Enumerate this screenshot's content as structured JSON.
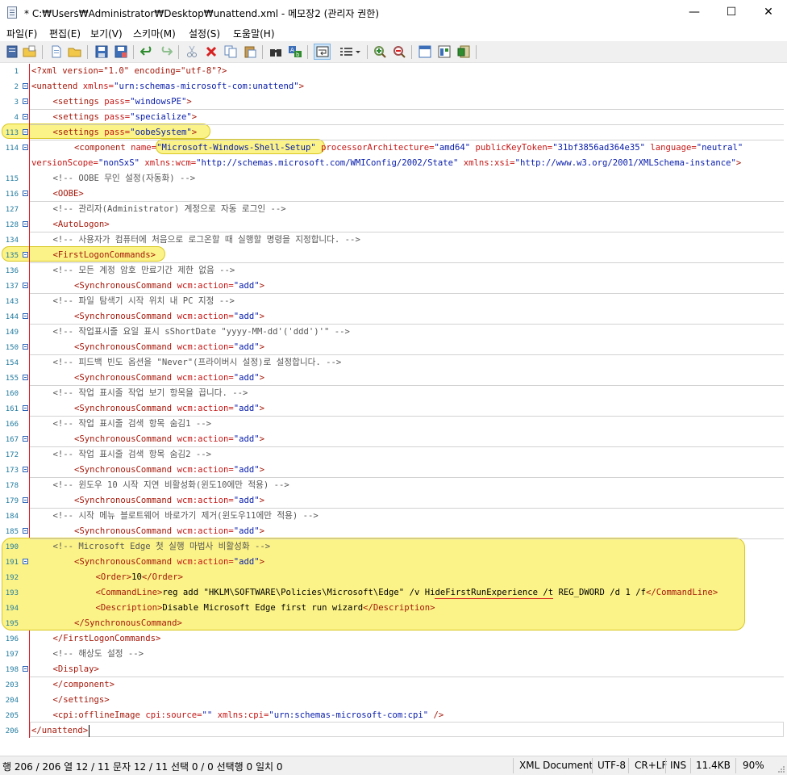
{
  "window": {
    "title": "* C:₩Users₩Administrator₩Desktop₩unattend.xml - 메모장2 (관리자 권한)",
    "minimize": "—",
    "maximize": "☐",
    "close": "✕"
  },
  "menu": [
    "파일(F)",
    "편집(E)",
    "보기(V)",
    "스키마(M)",
    "설정(S)",
    "도움말(H)"
  ],
  "toolbar": {
    "buttons": [
      "new",
      "open",
      "browse",
      "open-file",
      "save",
      "save-as",
      "undo",
      "redo",
      "cut",
      "delete",
      "copy",
      "paste",
      "find",
      "replace",
      "word-wrap",
      "line-numbers",
      "zoom-in",
      "zoom-out",
      "view",
      "settings",
      "export"
    ]
  },
  "lines": [
    {
      "num": "1",
      "fold": false,
      "indent": 0,
      "segs": [
        [
          "pi",
          "<?xml version=\"1.0\" encoding=\"utf-8\"?>"
        ]
      ]
    },
    {
      "num": "2",
      "fold": true,
      "indent": 0,
      "segs": [
        [
          "tag",
          "<unattend "
        ],
        [
          "attr",
          "xmlns="
        ],
        [
          "val",
          "\"urn:schemas-microsoft-com:unattend\""
        ],
        [
          "tag",
          ">"
        ]
      ]
    },
    {
      "num": "3",
      "fold": true,
      "indent": 1,
      "segs": [
        [
          "tag",
          "<settings "
        ],
        [
          "attr",
          "pass="
        ],
        [
          "val",
          "\"windowsPE\""
        ],
        [
          "tag",
          ">"
        ]
      ]
    },
    {
      "num": "4",
      "fold": true,
      "indent": 1,
      "segs": [
        [
          "tag",
          "<settings "
        ],
        [
          "attr",
          "pass="
        ],
        [
          "val",
          "\"specialize\""
        ],
        [
          "tag",
          ">"
        ]
      ]
    },
    {
      "num": "113",
      "fold": true,
      "indent": 1,
      "segs": [
        [
          "tag",
          "<settings "
        ],
        [
          "attr",
          "pass="
        ],
        [
          "val",
          "\"oobeSystem\""
        ],
        [
          "tag",
          ">"
        ]
      ]
    },
    {
      "num": "114",
      "fold": true,
      "indent": 2,
      "segs": [
        [
          "tag",
          "<component "
        ],
        [
          "attr",
          "name="
        ],
        [
          "val",
          "\"Microsoft-Windows-Shell-Setup\""
        ],
        [
          "attr",
          " processorArchitecture="
        ],
        [
          "val",
          "\"amd64\""
        ],
        [
          "attr",
          " publicKeyToken="
        ],
        [
          "val",
          "\"31bf3856ad364e35\""
        ],
        [
          "attr",
          " language="
        ],
        [
          "val",
          "\"neutral\""
        ]
      ]
    },
    {
      "num": "",
      "fold": false,
      "indent": 0,
      "segs": [
        [
          "attr",
          "versionScope="
        ],
        [
          "val",
          "\"nonSxS\""
        ],
        [
          "attr",
          " xmlns:wcm="
        ],
        [
          "val",
          "\"http://schemas.microsoft.com/WMIConfig/2002/State\""
        ],
        [
          "attr",
          " xmlns:xsi="
        ],
        [
          "val",
          "\"http://www.w3.org/2001/XMLSchema-instance\""
        ],
        [
          "tag",
          ">"
        ]
      ]
    },
    {
      "num": "115",
      "fold": false,
      "indent": 1,
      "segs": [
        [
          "cmt",
          "<!-- OOBE 무인 설정(자동화) -->"
        ]
      ]
    },
    {
      "num": "116",
      "fold": true,
      "indent": 1,
      "segs": [
        [
          "tag",
          "<OOBE>"
        ]
      ]
    },
    {
      "num": "127",
      "fold": false,
      "indent": 1,
      "segs": [
        [
          "cmt",
          "<!-- 관리자(Administrator) 계정으로 자동 로그인 -->"
        ]
      ]
    },
    {
      "num": "128",
      "fold": true,
      "indent": 1,
      "segs": [
        [
          "tag",
          "<AutoLogon>"
        ]
      ]
    },
    {
      "num": "134",
      "fold": false,
      "indent": 1,
      "segs": [
        [
          "cmt",
          "<!-- 사용자가 컴퓨터에 처음으로 로그온할 때 실행할 명령을 지정합니다. -->"
        ]
      ]
    },
    {
      "num": "135",
      "fold": true,
      "indent": 1,
      "segs": [
        [
          "tag",
          "<FirstLogonCommands>"
        ]
      ]
    },
    {
      "num": "136",
      "fold": false,
      "indent": 1,
      "segs": [
        [
          "cmt",
          "<!-- 모든 계정 암호 만료기간 제한 없음 -->"
        ]
      ]
    },
    {
      "num": "137",
      "fold": true,
      "indent": 2,
      "segs": [
        [
          "tag",
          "<SynchronousCommand "
        ],
        [
          "attr",
          "wcm:action="
        ],
        [
          "val",
          "\"add\""
        ],
        [
          "tag",
          ">"
        ]
      ]
    },
    {
      "num": "143",
      "fold": false,
      "indent": 1,
      "segs": [
        [
          "cmt",
          "<!-- 파일 탐색기 시작 위치 내 PC 지정 -->"
        ]
      ]
    },
    {
      "num": "144",
      "fold": true,
      "indent": 2,
      "segs": [
        [
          "tag",
          "<SynchronousCommand "
        ],
        [
          "attr",
          "wcm:action="
        ],
        [
          "val",
          "\"add\""
        ],
        [
          "tag",
          ">"
        ]
      ]
    },
    {
      "num": "149",
      "fold": false,
      "indent": 1,
      "segs": [
        [
          "cmt",
          "<!-- 작업표시줄 요일 표시 sShortDate \"yyyy-MM-dd'('ddd')'\" -->"
        ]
      ]
    },
    {
      "num": "150",
      "fold": true,
      "indent": 2,
      "segs": [
        [
          "tag",
          "<SynchronousCommand "
        ],
        [
          "attr",
          "wcm:action="
        ],
        [
          "val",
          "\"add\""
        ],
        [
          "tag",
          ">"
        ]
      ]
    },
    {
      "num": "154",
      "fold": false,
      "indent": 1,
      "segs": [
        [
          "cmt",
          "<!-- 피드백 빈도 옵션을 \"Never\"(프라이버시 설정)로 설정합니다. -->"
        ]
      ]
    },
    {
      "num": "155",
      "fold": true,
      "indent": 2,
      "segs": [
        [
          "tag",
          "<SynchronousCommand "
        ],
        [
          "attr",
          "wcm:action="
        ],
        [
          "val",
          "\"add\""
        ],
        [
          "tag",
          ">"
        ]
      ]
    },
    {
      "num": "160",
      "fold": false,
      "indent": 1,
      "segs": [
        [
          "cmt",
          "<!-- 작업 표시줄 작업 보기 항목을 끕니다. -->"
        ]
      ]
    },
    {
      "num": "161",
      "fold": true,
      "indent": 2,
      "segs": [
        [
          "tag",
          "<SynchronousCommand "
        ],
        [
          "attr",
          "wcm:action="
        ],
        [
          "val",
          "\"add\""
        ],
        [
          "tag",
          ">"
        ]
      ]
    },
    {
      "num": "166",
      "fold": false,
      "indent": 1,
      "segs": [
        [
          "cmt",
          "<!-- 작업 표시줄 검색 항목 숨김1 -->"
        ]
      ]
    },
    {
      "num": "167",
      "fold": true,
      "indent": 2,
      "segs": [
        [
          "tag",
          "<SynchronousCommand "
        ],
        [
          "attr",
          "wcm:action="
        ],
        [
          "val",
          "\"add\""
        ],
        [
          "tag",
          ">"
        ]
      ]
    },
    {
      "num": "172",
      "fold": false,
      "indent": 1,
      "segs": [
        [
          "cmt",
          "<!-- 작업 표시줄 검색 항목 숨김2 -->"
        ]
      ]
    },
    {
      "num": "173",
      "fold": true,
      "indent": 2,
      "segs": [
        [
          "tag",
          "<SynchronousCommand "
        ],
        [
          "attr",
          "wcm:action="
        ],
        [
          "val",
          "\"add\""
        ],
        [
          "tag",
          ">"
        ]
      ]
    },
    {
      "num": "178",
      "fold": false,
      "indent": 1,
      "segs": [
        [
          "cmt",
          "<!-- 윈도우 10 시작 지연 비활성화(윈도10에만 적용) -->"
        ]
      ]
    },
    {
      "num": "179",
      "fold": true,
      "indent": 2,
      "segs": [
        [
          "tag",
          "<SynchronousCommand "
        ],
        [
          "attr",
          "wcm:action="
        ],
        [
          "val",
          "\"add\""
        ],
        [
          "tag",
          ">"
        ]
      ]
    },
    {
      "num": "184",
      "fold": false,
      "indent": 1,
      "segs": [
        [
          "cmt",
          "<!-- 시작 메뉴 블로트웨어 바로가기 제거(윈도우11에만 적용) -->"
        ]
      ]
    },
    {
      "num": "185",
      "fold": true,
      "indent": 2,
      "segs": [
        [
          "tag",
          "<SynchronousCommand "
        ],
        [
          "attr",
          "wcm:action="
        ],
        [
          "val",
          "\"add\""
        ],
        [
          "tag",
          ">"
        ]
      ]
    },
    {
      "num": "190",
      "fold": false,
      "indent": 1,
      "segs": [
        [
          "cmt",
          "<!-- Microsoft Edge 첫 실행 마법사 비활성화 -->"
        ]
      ]
    },
    {
      "num": "191",
      "fold": true,
      "indent": 2,
      "segs": [
        [
          "tag",
          "<SynchronousCommand "
        ],
        [
          "attr",
          "wcm:action="
        ],
        [
          "val",
          "\"add\""
        ],
        [
          "tag",
          ">"
        ]
      ]
    },
    {
      "num": "192",
      "fold": false,
      "indent": 3,
      "segs": [
        [
          "tag",
          "<Order>"
        ],
        [
          "txt",
          "10"
        ],
        [
          "tag",
          "</Order>"
        ]
      ]
    },
    {
      "num": "193",
      "fold": false,
      "indent": 3,
      "segs": [
        [
          "tag",
          "<CommandLine>"
        ],
        [
          "txt",
          "reg add \"HKLM\\SOFTWARE\\Policies\\Microsoft\\Edge\" /v HideFirstRunExperience /t REG_DWORD /d 1 /f"
        ],
        [
          "tag",
          "</CommandLine>"
        ]
      ]
    },
    {
      "num": "194",
      "fold": false,
      "indent": 3,
      "segs": [
        [
          "tag",
          "<Description>"
        ],
        [
          "txt",
          "Disable Microsoft Edge first run wizard"
        ],
        [
          "tag",
          "</Description>"
        ]
      ]
    },
    {
      "num": "195",
      "fold": false,
      "indent": 2,
      "segs": [
        [
          "tag",
          "</SynchronousCommand>"
        ]
      ]
    },
    {
      "num": "196",
      "fold": false,
      "indent": 1,
      "segs": [
        [
          "tag",
          "</FirstLogonCommands>"
        ]
      ]
    },
    {
      "num": "197",
      "fold": false,
      "indent": 1,
      "segs": [
        [
          "cmt",
          "<!-- 해상도 설정 -->"
        ]
      ]
    },
    {
      "num": "198",
      "fold": true,
      "indent": 1,
      "segs": [
        [
          "tag",
          "<Display>"
        ]
      ]
    },
    {
      "num": "203",
      "fold": false,
      "indent": 1,
      "segs": [
        [
          "tag",
          "</component>"
        ]
      ]
    },
    {
      "num": "204",
      "fold": false,
      "indent": 1,
      "segs": [
        [
          "tag",
          "</settings>"
        ]
      ]
    },
    {
      "num": "205",
      "fold": false,
      "indent": 1,
      "segs": [
        [
          "tag",
          "<cpi:offlineImage "
        ],
        [
          "attr",
          "cpi:source="
        ],
        [
          "val",
          "\"\""
        ],
        [
          "attr",
          " xmlns:cpi="
        ],
        [
          "val",
          "\"urn:schemas-microsoft-com:cpi\""
        ],
        [
          "tag",
          " />"
        ]
      ]
    },
    {
      "num": "206",
      "fold": false,
      "indent": 0,
      "segs": [
        [
          "tag",
          "</unattend>"
        ]
      ]
    }
  ],
  "status": {
    "position": "행 206 / 206  열 12 / 11  문자 12 / 11  선택 0 / 0  선택행 0  일치 0",
    "mode": "XML Document",
    "encoding": "UTF-8",
    "eol": "CR+LF",
    "ins": "INS",
    "size": "11.4KB",
    "zoom": "90%"
  },
  "colors": {
    "tag": "#a6190b",
    "attr": "#c61716",
    "value": "#071cab",
    "comment": "#575757",
    "highlight": "#fbf387",
    "linenumber": "#207a9f"
  }
}
